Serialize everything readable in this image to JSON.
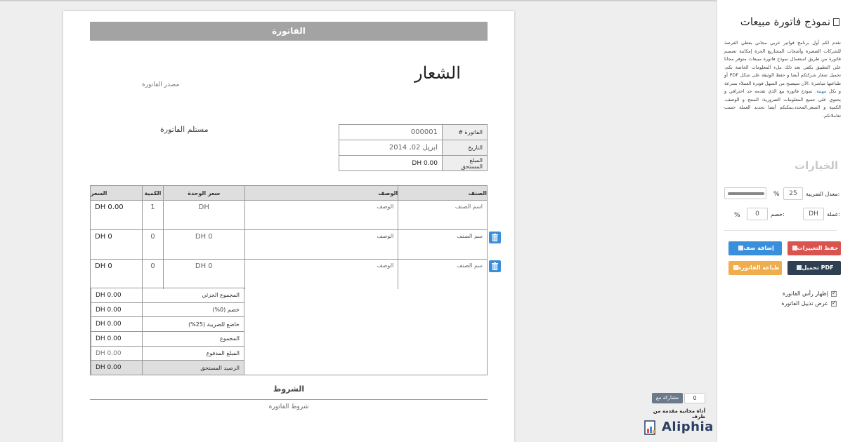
{
  "invoice": {
    "header_title": "الفاتورة",
    "logo_text": "الشعار",
    "sender_placeholder": "مصدر الفاتورة",
    "recipient_label": "مستلم الفاتورة",
    "meta": [
      {
        "label": "الفاتورة #",
        "value": "000001"
      },
      {
        "label": "التاريخ",
        "value": "ابريل 02, 2014"
      },
      {
        "label": "المبلغ المستحق",
        "value": "DH 0.00"
      }
    ],
    "columns": {
      "item": "الصنف",
      "description": "الوصف",
      "unit_price": "سعر الوحدة",
      "quantity": "الكمية",
      "price": "السعر"
    },
    "rows": [
      {
        "item": "اسم الصنف",
        "description": "الوصف",
        "unit_price": "DH",
        "quantity": "1",
        "price": "DH 0.00"
      },
      {
        "item": "سم الصنف",
        "description": "الوصف",
        "unit_price": "DH 0",
        "quantity": "0",
        "price": "DH 0"
      },
      {
        "item": "سم الصنف",
        "description": "الوصف",
        "unit_price": "DH 0",
        "quantity": "0",
        "price": "DH 0"
      }
    ],
    "totals": [
      {
        "label": "المجموع الجزئي",
        "value": "DH 0.00"
      },
      {
        "label": "خصم (0%)",
        "value": "DH 0.00"
      },
      {
        "label": "خاضع للضريبة (25%)",
        "value": "DH 0.00"
      },
      {
        "label": "المجموع",
        "value": "DH 0.00"
      },
      {
        "label": "المبلغ المدفوع",
        "value": "DH 0.00"
      },
      {
        "label": "الرصيد المستحق",
        "value": "DH 0.00"
      }
    ],
    "terms_title": "الشروط",
    "terms_text": "شروط الفاتورة"
  },
  "sidebar": {
    "title": "نموذج فاتورة مبيعات",
    "description_1": "نقدم لكم أول برنامج فواتير عربي مجاني يعطي الفرصة للشركات الصغيرة وأصحاب المشاريع الحرة إمكانية تصميم فاتورة من طريق استعمال نموذج فاتورة مبيعات متوفر مجانا على التطبيق يكفي بعد ذلك ملء المعلومات الخاصة بكم، تحميل شعار شركتكم أيضا و حفظ الوثيقة على شكل PDF أو طباعتها مباشرة .الآن سيصبح من السهل فوترة العملاء بسرعة و بكل",
    "description_highlight": "مهنية.",
    "description_2": "نموذج فاتورة بيع الذي نقدمه جد احترافي و يحتوي على جميع المعلومات الضرورية: المنتج و الوصف، الكمية و السعر.المحدد.يمكنكم أيضا تحديد العملة حسب تعاملاتكم.",
    "options_title": "الخيارات",
    "tax_label": "معدل الضريبة:",
    "tax_value": "25",
    "percent_sign": "%",
    "currency_label": "عملة:",
    "currency_value": "DH",
    "discount_label": "خصم:",
    "discount_value": "0",
    "buttons": {
      "save": "حفظ التغييرات",
      "add_row": "إضافة صف",
      "download_pdf": "تحميل PDF",
      "print": "طباعة الفاتورة"
    },
    "checkboxes": [
      {
        "label": "إظهار رأس الفاتورة"
      },
      {
        "label": "عرض تذييل الفاتورة"
      }
    ]
  },
  "branding": {
    "share_label": "مشاركة مع",
    "share_count": "0",
    "tool_text": "أداة مجانية مقدمة من طرف",
    "brand_name": "Aliphia"
  },
  "colors": {
    "header_gray": "#a3a3a3",
    "delete_blue": "#3a8fdc",
    "save_red": "#d9534f",
    "pdf_dark": "#2e4052",
    "print_orange": "#f0ad4e",
    "brand_navy": "#2c3e62"
  }
}
